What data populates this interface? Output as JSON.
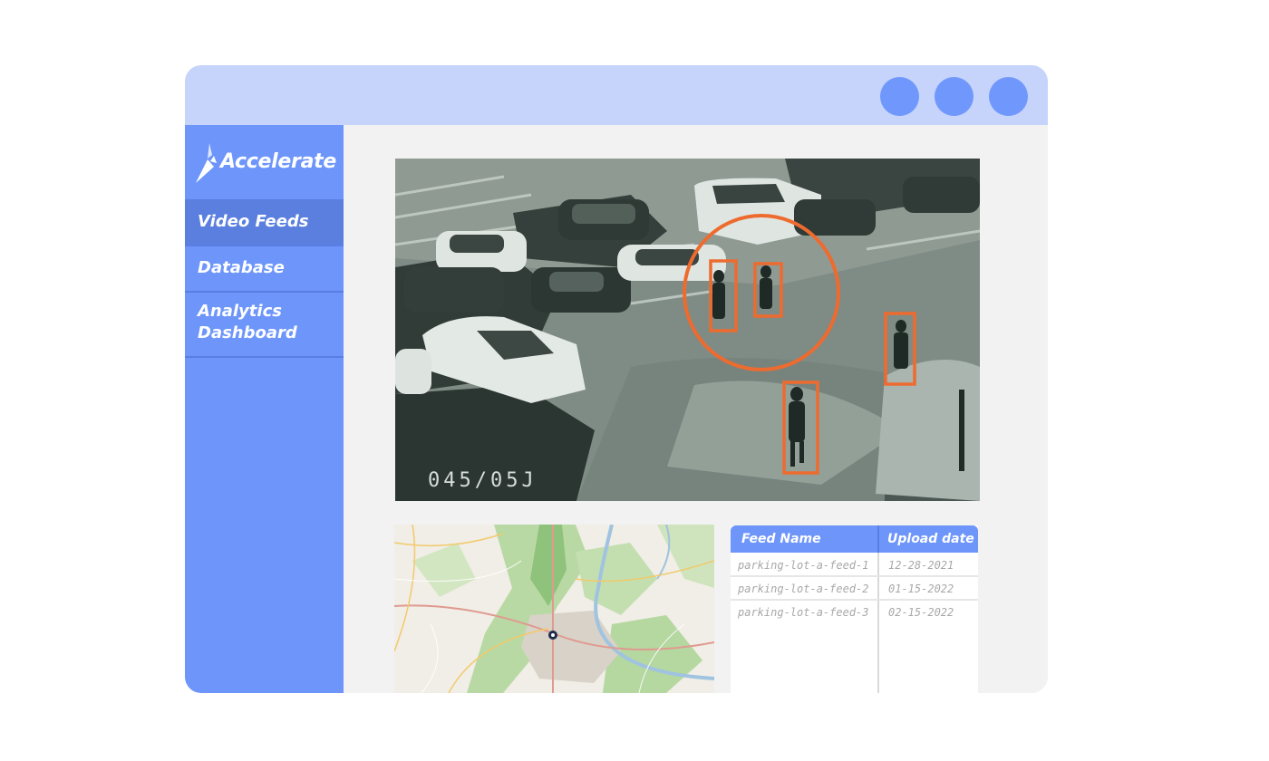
{
  "window": {
    "controls": [
      "window-control",
      "window-control",
      "window-control"
    ]
  },
  "brand": {
    "name": "Accelerate"
  },
  "sidebar": {
    "items": [
      {
        "label": "Video Feeds",
        "active": true
      },
      {
        "label": "Database",
        "active": false
      },
      {
        "label": "Analytics Dashboard",
        "label_line1": "Analytics",
        "label_line2": "Dashboard",
        "active": false
      }
    ]
  },
  "video": {
    "overlay_text": "045/05J",
    "detections": 5,
    "highlight_color": "#ee6b2f"
  },
  "table": {
    "headers": [
      "Feed Name",
      "Upload date"
    ],
    "rows": [
      {
        "name": "parking-lot-a-feed-1",
        "date": "12-28-2021"
      },
      {
        "name": "parking-lot-a-feed-2",
        "date": "01-15-2022"
      },
      {
        "name": "parking-lot-a-feed-3",
        "date": "02-15-2022"
      }
    ]
  },
  "colors": {
    "accent": "#6d95fa",
    "titlebar": "#c6d4fb",
    "highlight": "#ee6b2f"
  }
}
